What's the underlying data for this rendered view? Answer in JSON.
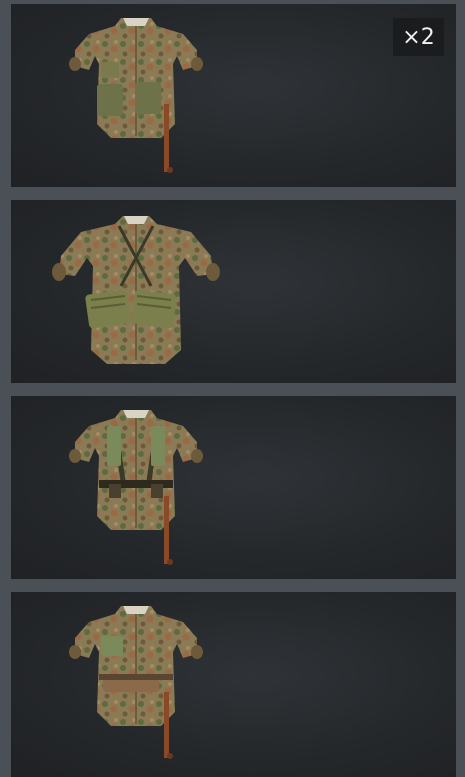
{
  "items": [
    {
      "name": "camo-uniform-with-ammo-pouches",
      "count_badge": "×2",
      "variant": "pouches-small"
    },
    {
      "name": "camo-uniform-with-magazine-pouches",
      "count_badge": "",
      "variant": "pouches-large"
    },
    {
      "name": "camo-uniform-with-y-straps",
      "count_badge": "",
      "variant": "ystraps"
    },
    {
      "name": "camo-uniform-with-bread-bag",
      "count_badge": "",
      "variant": "breadbag"
    }
  ],
  "colors": {
    "background": "#4a5055",
    "card": "#25282b",
    "badge": "#1a1c1e",
    "camo_base": "#8a7a55",
    "camo_dark": "#5d6b3e",
    "camo_brown": "#9a6a45",
    "strap": "#2e2a20",
    "pouch": "#7d8050",
    "stick": "#8a4a28"
  }
}
